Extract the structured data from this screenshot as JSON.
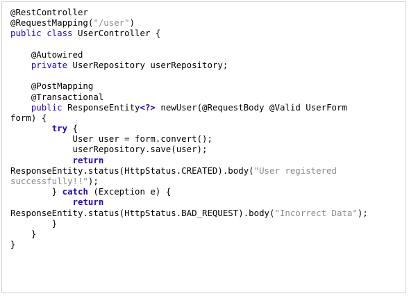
{
  "code": {
    "lines": [
      [
        {
          "t": "@RestController",
          "c": "ann"
        }
      ],
      [
        {
          "t": "@RequestMapping(",
          "c": "ann"
        },
        {
          "t": "\"/user\"",
          "c": "str"
        },
        {
          "t": ")",
          "c": "ann"
        }
      ],
      [
        {
          "t": "public class",
          "c": "kw"
        },
        {
          "t": " UserController {",
          "c": "plain"
        }
      ],
      [],
      [
        {
          "t": "    @Autowired",
          "c": "ann"
        }
      ],
      [
        {
          "t": "    ",
          "c": "plain"
        },
        {
          "t": "private",
          "c": "kw"
        },
        {
          "t": " UserRepository userRepository;",
          "c": "plain"
        }
      ],
      [],
      [
        {
          "t": "    @PostMapping",
          "c": "ann"
        }
      ],
      [
        {
          "t": "    @Transactional",
          "c": "ann"
        }
      ],
      [
        {
          "t": "    ",
          "c": "plain"
        },
        {
          "t": "public",
          "c": "kw"
        },
        {
          "t": " ResponseEntity",
          "c": "plain"
        },
        {
          "t": "<?>",
          "c": "kwb"
        },
        {
          "t": " newUser(@RequestBody @Valid UserForm",
          "c": "plain"
        }
      ],
      [
        {
          "t": "form) {",
          "c": "plain"
        }
      ],
      [
        {
          "t": "        ",
          "c": "plain"
        },
        {
          "t": "try",
          "c": "kwb"
        },
        {
          "t": " {",
          "c": "plain"
        }
      ],
      [
        {
          "t": "            User user = form.convert();",
          "c": "plain"
        }
      ],
      [
        {
          "t": "            userRepository.save(user);",
          "c": "plain"
        }
      ],
      [
        {
          "t": "            ",
          "c": "plain"
        },
        {
          "t": "return",
          "c": "kwb"
        }
      ],
      [
        {
          "t": "ResponseEntity.status(HttpStatus.CREATED).body(",
          "c": "plain"
        },
        {
          "t": "\"User registered",
          "c": "str"
        }
      ],
      [
        {
          "t": "successfully!!\"",
          "c": "str"
        },
        {
          "t": ");",
          "c": "plain"
        }
      ],
      [
        {
          "t": "        } ",
          "c": "plain"
        },
        {
          "t": "catch",
          "c": "kwb"
        },
        {
          "t": " (Exception e) {",
          "c": "plain"
        }
      ],
      [
        {
          "t": "            ",
          "c": "plain"
        },
        {
          "t": "return",
          "c": "kwb"
        }
      ],
      [
        {
          "t": "ResponseEntity.status(HttpStatus.BAD_REQUEST).body(",
          "c": "plain"
        },
        {
          "t": "\"Incorrect Data\"",
          "c": "str"
        },
        {
          "t": ");",
          "c": "plain"
        }
      ],
      [
        {
          "t": "        }",
          "c": "plain"
        }
      ],
      [
        {
          "t": "    }",
          "c": "plain"
        }
      ],
      [
        {
          "t": "}",
          "c": "plain"
        }
      ]
    ]
  }
}
